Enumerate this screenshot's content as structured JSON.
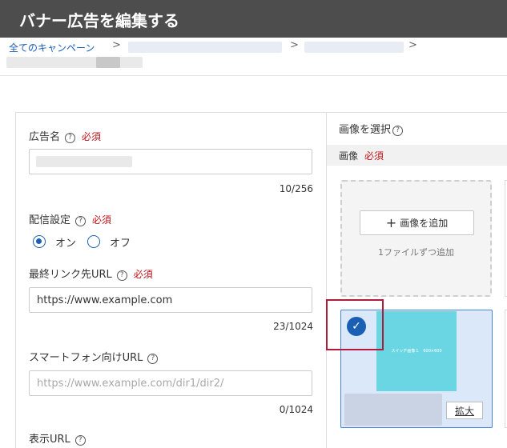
{
  "header": {
    "title": "バナー広告を編集する"
  },
  "breadcrumb": {
    "root": "全てのキャンペーン"
  },
  "form": {
    "ad_name": {
      "label": "広告名",
      "required": "必須",
      "counter": "10/256"
    },
    "delivery": {
      "label": "配信設定",
      "required": "必須",
      "on_label": "オン",
      "off_label": "オフ",
      "selected": "オン"
    },
    "final_url": {
      "label": "最終リンク先URL",
      "required": "必須",
      "value": "https://www.example.com",
      "counter": "23/1024"
    },
    "smartphone_url": {
      "label": "スマートフォン向けURL",
      "placeholder": "https://www.example.com/dir1/dir2/",
      "counter": "0/1024"
    },
    "display_url": {
      "label": "表示URL"
    }
  },
  "image_panel": {
    "title": "画像を選択",
    "image_label": "画像",
    "required": "必須",
    "add_button": "画像を追加",
    "add_note": "1ファイルずつ追加",
    "thumbnail_caption": "スイッチ画像１　600×600",
    "zoom_button": "拡大"
  },
  "icons": {
    "help": "help-circle-icon",
    "check": "checkmark-icon",
    "plus": "plus-icon",
    "chevron": "chevron-right-icon"
  },
  "colors": {
    "header_bg": "#4d4d4d",
    "link": "#1a5fb4",
    "required": "#c0141b",
    "thumb": "#6ad6e3",
    "selected_card": "#dbe8f9",
    "highlight": "#b21a3c"
  }
}
